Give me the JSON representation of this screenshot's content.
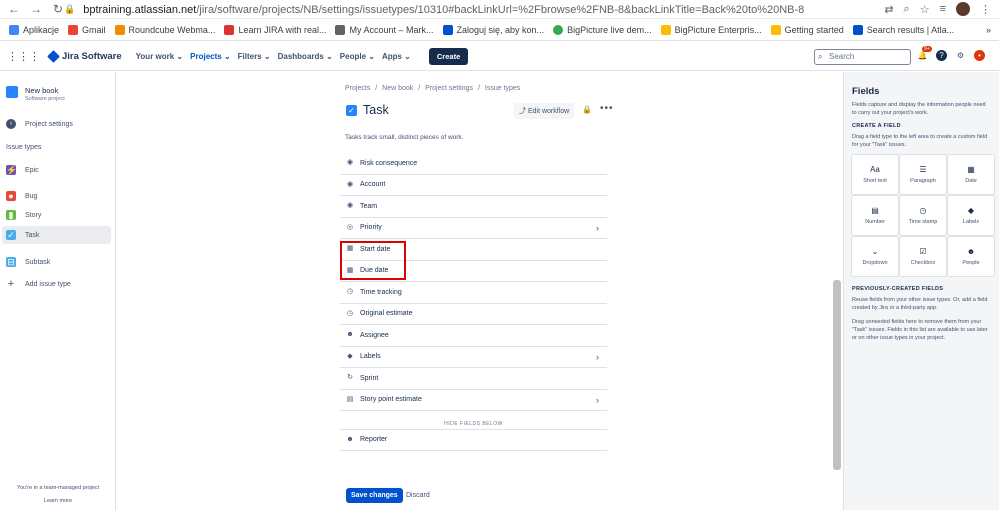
{
  "browser": {
    "url_host": "bptraining.atlassian.net",
    "url_path": "/jira/software/projects/NB/settings/issuetypes/10310#backLinkUrl=%2Fbrowse%2FNB-8&backLinkTitle=Back%20to%20NB-8",
    "bookmarks": [
      "Aplikacje",
      "Gmail",
      "Roundcube Webma...",
      "Learn JIRA with real...",
      "My Account – Mark...",
      "Zaloguj się, aby kon...",
      "BigPicture live dem...",
      "BigPicture Enterpris...",
      "Getting started",
      "Search results | Atla..."
    ]
  },
  "topbar": {
    "product": "Jira Software",
    "nav": [
      "Your work",
      "Projects",
      "Filters",
      "Dashboards",
      "People",
      "Apps"
    ],
    "create": "Create",
    "search_placeholder": "Search",
    "notif_badge": "9+"
  },
  "sidebar": {
    "project_name": "New book",
    "project_type": "Software project",
    "settings": "Project settings",
    "heading": "Issue types",
    "types": [
      "Epic",
      "Bug",
      "Story",
      "Task",
      "Subtask"
    ],
    "add": "Add issue type",
    "foot1": "You're in a team-managed project",
    "foot2": "Learn more"
  },
  "main": {
    "breadcrumbs": [
      "Projects",
      "/",
      "New book",
      "/",
      "Project settings",
      "/",
      "Issue types"
    ],
    "title": "Task",
    "edit_workflow": "Edit workflow",
    "description": "Tasks track small, distinct pieces of work.",
    "fields": [
      "Risk consequence",
      "Account",
      "Team",
      "Priority",
      "Start date",
      "Due date",
      "Time tracking",
      "Original estimate",
      "Assignee",
      "Labels",
      "Sprint",
      "Story point estimate"
    ],
    "hide_label": "HIDE FIELDS BELOW",
    "hidden_fields": [
      "Reporter"
    ],
    "save": "Save changes",
    "discard": "Discard"
  },
  "panel": {
    "title": "Fields",
    "intro": "Fields capture and display the information people need to carry out your project's work.",
    "create_heading": "CREATE A FIELD",
    "create_text": "Drag a field type to the left area to create a custom field for your \"Task\" issues.",
    "tiles": [
      "Short text",
      "Paragraph",
      "Date",
      "Number",
      "Time stamp",
      "Labels",
      "Dropdown",
      "Checkbox",
      "People"
    ],
    "prev_heading": "PREVIOUSLY-CREATED FIELDS",
    "prev_text": "Reuse fields from your other issue types. Or, add a field created by Jira or a third-party app.",
    "drag_text": "Drag unneeded fields here to remove them from your \"Task\" issues. Fields in this list are available to use later or on other issue types in your project."
  }
}
